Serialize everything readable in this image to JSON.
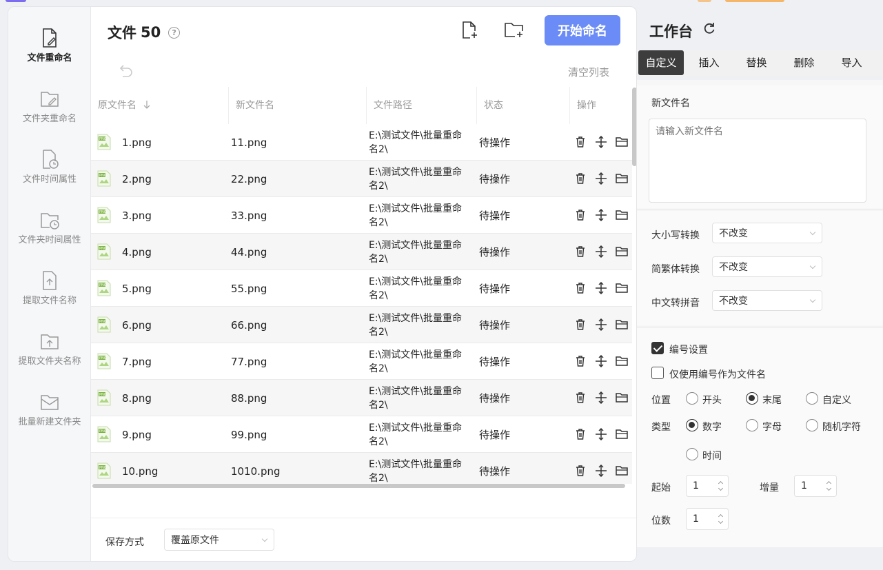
{
  "sidebar": {
    "items": [
      {
        "label": "文件重命名",
        "icon": "file-edit-icon",
        "active": true
      },
      {
        "label": "文件夹重命名",
        "icon": "folder-edit-icon"
      },
      {
        "label": "文件时间属性",
        "icon": "file-clock-icon"
      },
      {
        "label": "文件夹时间属性",
        "icon": "folder-clock-icon"
      },
      {
        "label": "提取文件名称",
        "icon": "file-upload-icon"
      },
      {
        "label": "提取文件夹名称",
        "icon": "folder-upload-icon"
      },
      {
        "label": "批量新建文件夹",
        "icon": "folder-mail-icon"
      }
    ]
  },
  "header": {
    "title": "文件",
    "count": "50",
    "help_glyph": "?",
    "start_label": "开始命名",
    "clear_label": "清空列表"
  },
  "table": {
    "columns": [
      "原文件名",
      "新文件名",
      "文件路径",
      "状态",
      "操作"
    ],
    "rows": [
      {
        "name": "1.png",
        "new_name": "11.png",
        "path": "E:\\测试文件\\批量重命名2\\",
        "status": "待操作"
      },
      {
        "name": "2.png",
        "new_name": "22.png",
        "path": "E:\\测试文件\\批量重命名2\\",
        "status": "待操作"
      },
      {
        "name": "3.png",
        "new_name": "33.png",
        "path": "E:\\测试文件\\批量重命名2\\",
        "status": "待操作"
      },
      {
        "name": "4.png",
        "new_name": "44.png",
        "path": "E:\\测试文件\\批量重命名2\\",
        "status": "待操作"
      },
      {
        "name": "5.png",
        "new_name": "55.png",
        "path": "E:\\测试文件\\批量重命名2\\",
        "status": "待操作"
      },
      {
        "name": "6.png",
        "new_name": "66.png",
        "path": "E:\\测试文件\\批量重命名2\\",
        "status": "待操作"
      },
      {
        "name": "7.png",
        "new_name": "77.png",
        "path": "E:\\测试文件\\批量重命名2\\",
        "status": "待操作"
      },
      {
        "name": "8.png",
        "new_name": "88.png",
        "path": "E:\\测试文件\\批量重命名2\\",
        "status": "待操作"
      },
      {
        "name": "9.png",
        "new_name": "99.png",
        "path": "E:\\测试文件\\批量重命名2\\",
        "status": "待操作"
      },
      {
        "name": "10.png",
        "new_name": "1010.png",
        "path": "E:\\测试文件\\批量重命名2\\",
        "status": "待操作"
      }
    ]
  },
  "footer": {
    "save_label": "保存方式",
    "save_value": "覆盖原文件"
  },
  "panel": {
    "title": "工作台",
    "tabs": [
      "自定义",
      "插入",
      "替换",
      "删除",
      "导入"
    ],
    "new_name_label": "新文件名",
    "new_name_placeholder": "请输入新文件名",
    "case_label": "大小写转换",
    "case_value": "不改变",
    "trad_label": "简繁体转换",
    "trad_value": "不改变",
    "pinyin_label": "中文转拼音",
    "pinyin_value": "不改变",
    "numbering_label": "编号设置",
    "numbering_checked": true,
    "only_number_label": "仅使用编号作为文件名",
    "only_number_checked": false,
    "position_label": "位置",
    "position_options": [
      "开头",
      "末尾",
      "自定义"
    ],
    "position_selected": "末尾",
    "type_label": "类型",
    "type_options": [
      "数字",
      "字母",
      "随机字符",
      "时间"
    ],
    "type_selected": "数字",
    "start_label": "起始",
    "start_value": "1",
    "step_label": "增量",
    "step_value": "1",
    "digits_label": "位数",
    "digits_value": "1"
  },
  "colors": {
    "accent": "#6b8cf7",
    "dark_tab": "#3d3d3d",
    "png_icon": "#7cb342"
  }
}
